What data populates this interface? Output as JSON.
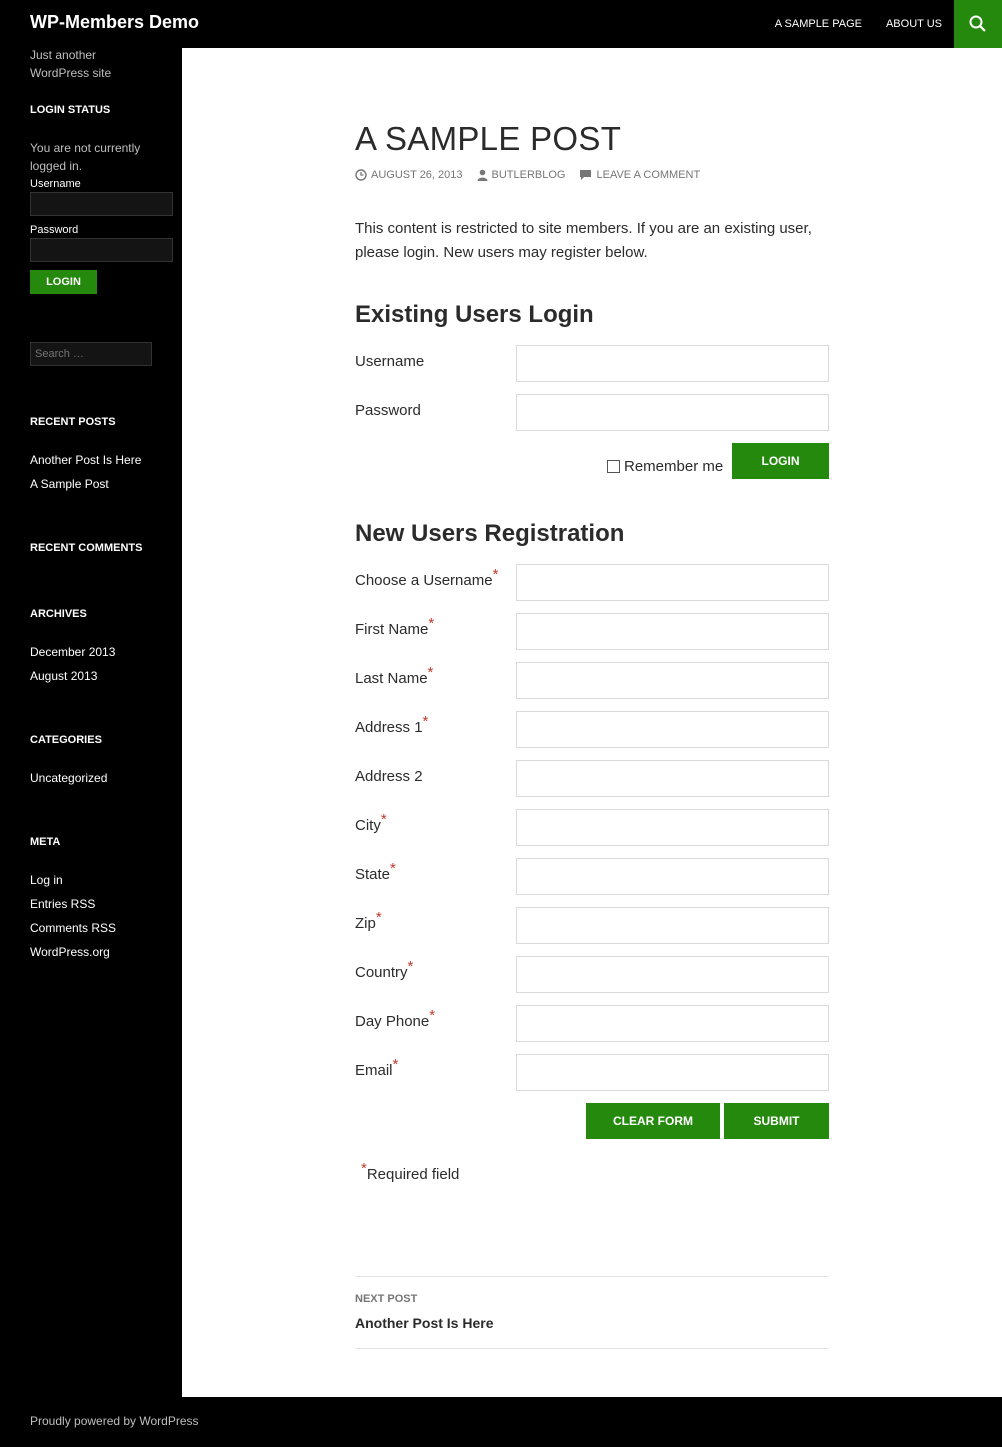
{
  "site": {
    "title": "WP-Members Demo",
    "tagline": "Just another WordPress site"
  },
  "nav": {
    "items": [
      "A SAMPLE PAGE",
      "ABOUT US"
    ],
    "search_icon": "search-icon"
  },
  "sidebar": {
    "login_status": {
      "title": "LOGIN STATUS",
      "status_text": "You are not currently logged in.",
      "username_label": "Username",
      "password_label": "Password",
      "login_button": "LOGIN"
    },
    "search_placeholder": "Search …",
    "recent_posts": {
      "title": "RECENT POSTS",
      "items": [
        "Another Post Is Here",
        "A Sample Post"
      ]
    },
    "recent_comments": {
      "title": "RECENT COMMENTS"
    },
    "archives": {
      "title": "ARCHIVES",
      "items": [
        "December 2013",
        "August 2013"
      ]
    },
    "categories": {
      "title": "CATEGORIES",
      "items": [
        "Uncategorized"
      ]
    },
    "meta": {
      "title": "META",
      "items": [
        "Log in",
        "Entries RSS",
        "Comments RSS",
        "WordPress.org"
      ]
    }
  },
  "post": {
    "title": "A SAMPLE POST",
    "date": "AUGUST 26, 2013",
    "author": "BUTLERBLOG",
    "comment_link": "LEAVE A COMMENT",
    "restricted_text": "This content is restricted to site members. If you are an existing user, please login. New users may register below."
  },
  "login_form": {
    "heading": "Existing Users Login",
    "username_label": "Username",
    "password_label": "Password",
    "remember_label": "Remember me",
    "login_button": "LOGIN"
  },
  "registration": {
    "heading": "New Users Registration",
    "fields": [
      {
        "label": "Choose a Username",
        "required": "*"
      },
      {
        "label": "First Name",
        "required": "*"
      },
      {
        "label": "Last Name",
        "required": "*"
      },
      {
        "label": "Address 1",
        "required": "*"
      },
      {
        "label": "Address 2",
        "required": ""
      },
      {
        "label": "City",
        "required": "*"
      },
      {
        "label": "State",
        "required": "*"
      },
      {
        "label": "Zip",
        "required": "*"
      },
      {
        "label": "Country",
        "required": "*"
      },
      {
        "label": "Day Phone",
        "required": "*"
      },
      {
        "label": "Email",
        "required": "*"
      }
    ],
    "clear_button": "CLEAR FORM",
    "submit_button": "SUBMIT",
    "required_star": "*",
    "required_note": "Required field"
  },
  "post_nav": {
    "label": "NEXT POST",
    "title": "Another Post Is Here"
  },
  "footer": {
    "text": "Proudly powered by WordPress"
  },
  "colors": {
    "accent": "#24890d",
    "required": "#c0392b",
    "sidebar_bg": "#000000"
  }
}
